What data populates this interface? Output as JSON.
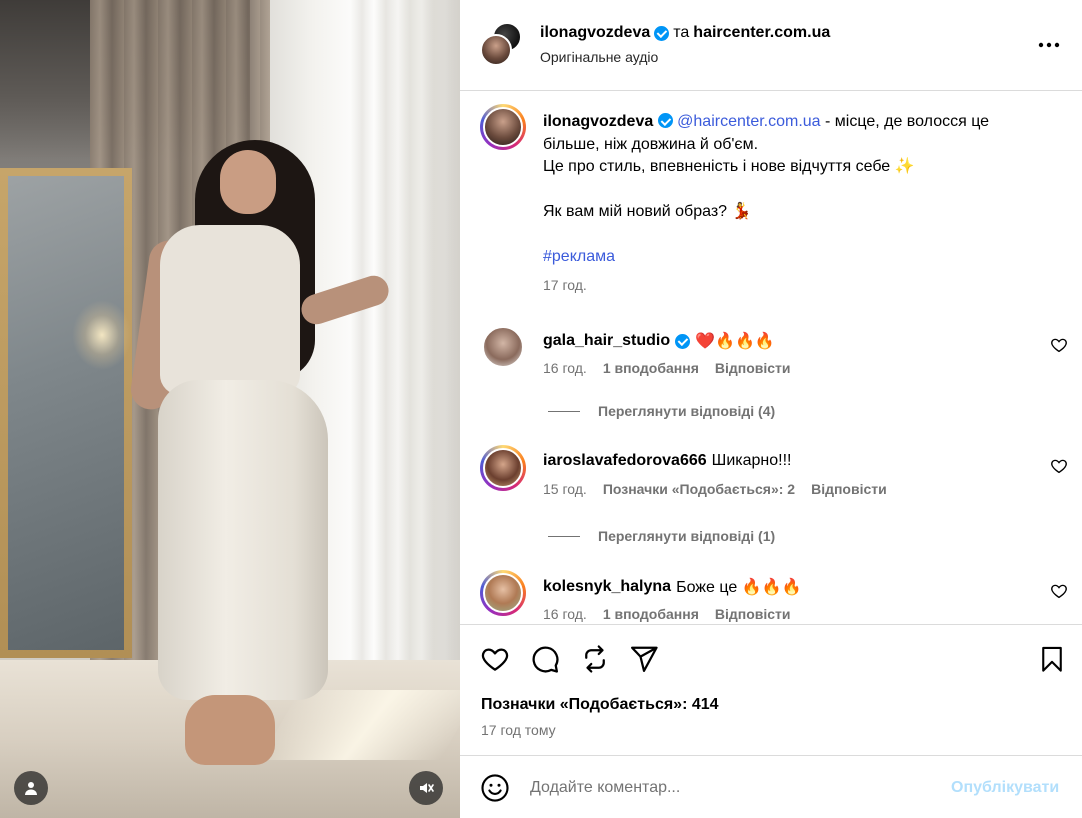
{
  "header": {
    "author": "ilonagvozdeva",
    "connector": "та",
    "collaborator": "haircenter.com.ua",
    "audio": "Оригінальне аудіо"
  },
  "caption": {
    "username": "ilonagvozdeva",
    "mention": "@haircenter.com.ua",
    "text_line1": " - місце, де волосся це більше, ніж довжина й об'єм.",
    "text_line2": "Це про стиль, впевненість і нове відчуття себе ✨",
    "text_line3": "Як вам мій новий образ? 💃",
    "hashtag": "#реклама",
    "time": "17 год."
  },
  "comments": [
    {
      "username": "gala_hair_studio",
      "verified": true,
      "text": "❤️🔥🔥🔥",
      "time": "16 год.",
      "likes": "1 вподобання",
      "reply": "Відповісти",
      "view_replies": "Переглянути відповіді (4)"
    },
    {
      "username": "iaroslavafedorova666",
      "verified": false,
      "text": "Шикарно!!!",
      "time": "15 год.",
      "likes": "Позначки «Подобається»: 2",
      "reply": "Відповісти",
      "view_replies": "Переглянути відповіді (1)"
    },
    {
      "username": "kolesnyk_halyna",
      "verified": false,
      "text": "Боже це 🔥🔥🔥",
      "time": "16 год.",
      "likes": "1 вподобання",
      "reply": "Відповісти"
    }
  ],
  "actions": {
    "likes_count": "Позначки «Подобається»: 414",
    "posted": "17 год тому"
  },
  "add_comment": {
    "placeholder": "Додайте коментар...",
    "post_label": "Опублікувати"
  },
  "icons": {
    "like": "heart-icon",
    "comment": "comment-icon",
    "repost": "repost-icon",
    "share": "send-icon",
    "save": "bookmark-icon",
    "more": "more-icon",
    "emoji": "emoji-icon",
    "user_tags": "user-icon",
    "mute": "muted-speaker-icon"
  },
  "colors": {
    "link": "#3b5bdb",
    "verified": "#0095f6",
    "post_button_disabled": "#b2dffc",
    "secondary_text": "#737373"
  }
}
